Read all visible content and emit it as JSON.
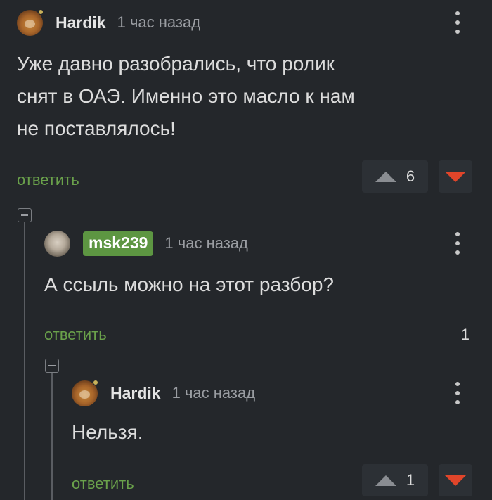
{
  "comments": [
    {
      "author": "Hardik",
      "time": "1 час назад",
      "text_lines": [
        "Уже давно разобрались, что ролик",
        "снят в ОАЭ. Именно это масло к нам",
        "не поставлялось!"
      ],
      "reply_label": "ответить",
      "rating": "6",
      "avatar_icon": "dog-avatar",
      "online": true
    },
    {
      "author": "msk239",
      "time": "1 час назад",
      "text_lines": [
        "А ссыль можно на этот разбор?"
      ],
      "reply_label": "ответить",
      "rating": "1",
      "avatar_icon": "person-avatar",
      "author_badge_color": "#5d9642"
    },
    {
      "author": "Hardik",
      "time": "1 час назад",
      "text_lines": [
        "Нельзя."
      ],
      "reply_label": "ответить",
      "rating": "1",
      "avatar_icon": "dog-avatar",
      "online": true
    }
  ],
  "colors": {
    "background": "#24272b",
    "reply_link": "#6aa14b",
    "downvote": "#e0452a",
    "upvote": "#8a8d92"
  }
}
